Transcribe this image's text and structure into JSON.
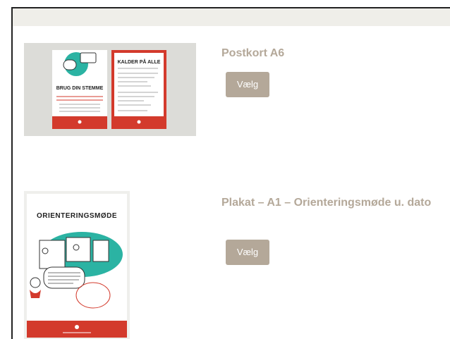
{
  "products": [
    {
      "title": "Postkort A6",
      "button_label": "Vælg",
      "front_card_text": "BRUG DIN STEMME",
      "back_card_text": "KALDER PÅ ALLE"
    },
    {
      "title": "Plakat – A1 – Orienteringsmøde u. dato",
      "button_label": "Vælg",
      "poster_heading": "ORIENTERINGSMØDE"
    }
  ],
  "colors": {
    "accent": "#b4a899",
    "red": "#d33a2c",
    "teal": "#2bb3a3"
  }
}
